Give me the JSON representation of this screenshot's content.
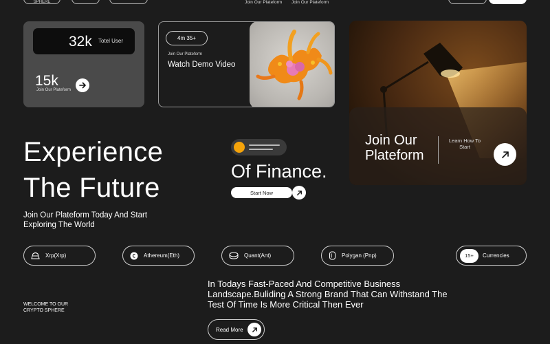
{
  "nav": {
    "logo_text": "SPHERE",
    "links": [
      "Join Our Plateform",
      "Join Our Plateform"
    ]
  },
  "stats_card": {
    "total_users_value": "32k",
    "total_users_label": "Totel User",
    "joined_value": "15k",
    "joined_caption": "Join Our Plateform"
  },
  "video_card": {
    "duration": "4m 35+",
    "caption": "Join Our Plateform",
    "title": "Watch Demo Video"
  },
  "promo_card": {
    "title": "Join Our Plateform",
    "link_label": "Learn How To Start"
  },
  "hero": {
    "title_line1": "Experience",
    "title_line2": "The Future",
    "subtitle": "Join Our Plateform Today And Start Exploring The World",
    "finance_text": "Of Finance.",
    "start_button": "Start Now"
  },
  "currencies": {
    "items": [
      {
        "label": "Xrp(Xrp)",
        "icon": "xrp-icon"
      },
      {
        "label": "Athereum(Eth)",
        "icon": "ethereum-icon"
      },
      {
        "label": "Quant(Ant)",
        "icon": "quant-icon"
      },
      {
        "label": "Polygan (Pnp)",
        "icon": "polygon-icon"
      }
    ],
    "count_badge": "15+",
    "count_label": "Currencies"
  },
  "about": {
    "welcome": "WELCOME TO OUR CRYPTO SPHERE",
    "body": "In Todays Fast-Paced And Competitive Business Landscape.Buliding A Strong Brand That Can Withstand The Test Of Time Is More Critical Then Ever",
    "read_more": "Read More"
  },
  "colors": {
    "background": "#1c1c1c",
    "accent": "#f5a30a",
    "card_gray": "#4a4a4a"
  }
}
